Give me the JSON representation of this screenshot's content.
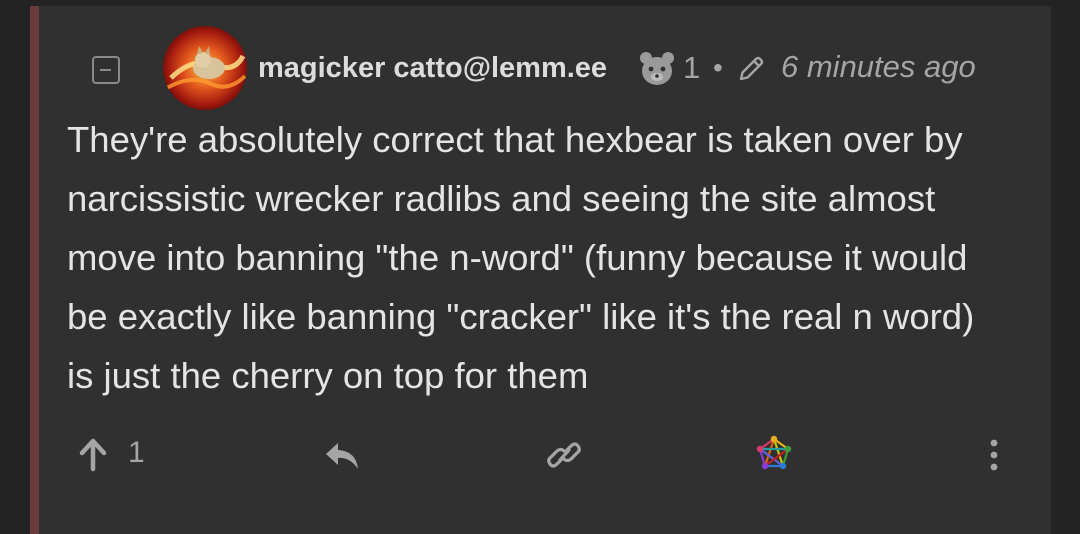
{
  "comment": {
    "author": "magicker catto@lemm.ee",
    "score": "1",
    "separator": "•",
    "time": "6 minutes ago",
    "body_lines": [
      "They're absolutely correct that hexbear is taken over by",
      "narcissistic wrecker radlibs and seeing the site almost",
      "move into banning \"the n-word\" (funny because it would",
      "be exactly like banning \"cracker\" like it's the real n word)",
      "is just the cherry on top for them"
    ]
  },
  "actions": {
    "upvote_count": "1"
  },
  "icons": {
    "collapse": "collapse-icon",
    "bot": "bot-account-icon",
    "edit": "pencil-icon",
    "upvote": "arrow-up-icon",
    "reply": "reply-icon",
    "link": "link-icon",
    "fediverse": "fediverse-icon",
    "more": "more-vertical-icon"
  },
  "colors": {
    "background": "#232323",
    "card": "#303030",
    "thread_bar": "#6b3a3a",
    "text": "#e4e4e4",
    "muted": "#a5a5a5"
  }
}
